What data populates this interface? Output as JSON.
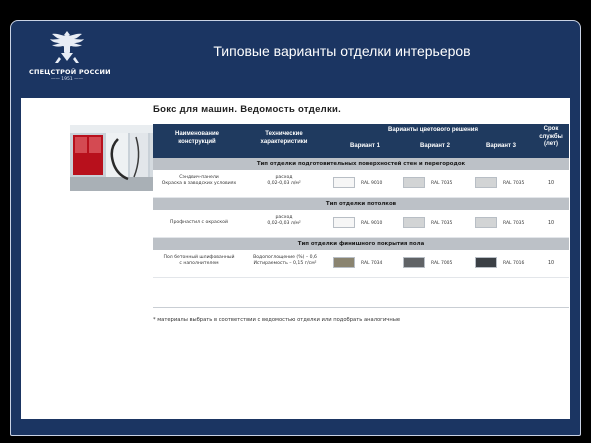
{
  "header": {
    "title": "Типовые варианты отделки интерьеров",
    "logo_name": "СПЕЦСТРОЙ РОССИИ",
    "logo_sub": "—— 1951 ——"
  },
  "subtitle": "Бокс для машин. Ведомость отделки.",
  "table": {
    "headers": {
      "name": "Наименование конструкций",
      "tech": "Технические характеристики",
      "variants": "Варианты цветового решения",
      "v1": "Вариант 1",
      "v2": "Вариант 2",
      "v3": "Вариант 3",
      "life": "Срок службы (лет)"
    },
    "sections": [
      {
        "title": "Тип отделки подготовительных поверхностей стен и перегородок",
        "row": {
          "name": [
            "Сэндвич-панели",
            "Окраска в заводских условиях"
          ],
          "tech": [
            "расход",
            "0,02-0,03 л/м²"
          ],
          "swatches": [
            {
              "color": "#f6f6f6",
              "label": "RAL 9010"
            },
            {
              "color": "#d2d4d5",
              "label": "RAL 7035"
            },
            {
              "color": "#d2d4d5",
              "label": "RAL 7035"
            }
          ],
          "life": "10"
        }
      },
      {
        "title": "Тип отделки потолков",
        "row": {
          "name": [
            "Профнастил с окраской"
          ],
          "tech": [
            "расход",
            "0,02-0,03 л/м²"
          ],
          "swatches": [
            {
              "color": "#f6f6f6",
              "label": "RAL 9010"
            },
            {
              "color": "#d2d4d5",
              "label": "RAL 7035"
            },
            {
              "color": "#d2d4d5",
              "label": "RAL 7035"
            }
          ],
          "life": "10"
        }
      },
      {
        "title": "Тип отделки финишного покрытия пола",
        "row": {
          "name": [
            "Пол бетонный шлифованный",
            "с наполнителем"
          ],
          "tech": [
            "Водопоглощение (%) – 0,6",
            "Истираемость – 0,15 г/см²"
          ],
          "swatches": [
            {
              "color": "#8a8470",
              "label": "RAL 7034"
            },
            {
              "color": "#606366",
              "label": "RAL 7005"
            },
            {
              "color": "#3b4045",
              "label": "RAL 7016"
            }
          ],
          "life": "10"
        }
      }
    ]
  },
  "note": "* материалы выбрать в соответствии с ведомостью отделки или подобрать аналогичные"
}
